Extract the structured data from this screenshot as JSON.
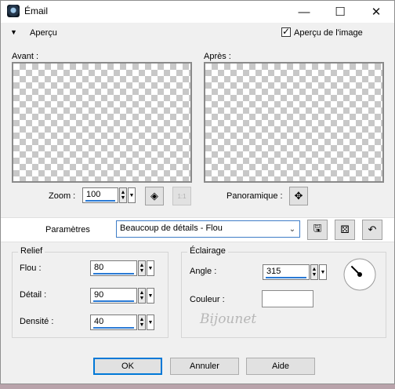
{
  "window": {
    "title": "Émail",
    "controls": {
      "minimize": "—",
      "maximize": "☐",
      "close": "✕"
    }
  },
  "preview": {
    "toggle_label": "Aperçu",
    "checkbox_label": "Aperçu de l'image",
    "checkbox_checked": true,
    "before_label": "Avant :",
    "after_label": "Après :"
  },
  "zoom": {
    "label": "Zoom :",
    "value": "100",
    "pan_label": "Panoramique :"
  },
  "params": {
    "label": "Paramètres",
    "preset": "Beaucoup de détails - Flou"
  },
  "relief": {
    "title": "Relief",
    "blur_label": "Flou :",
    "blur_value": "80",
    "detail_label": "Détail :",
    "detail_value": "90",
    "density_label": "Densité :",
    "density_value": "40"
  },
  "lighting": {
    "title": "Éclairage",
    "angle_label": "Angle :",
    "angle_value": "315",
    "color_label": "Couleur :",
    "color_value": "#ffffff"
  },
  "watermark": "Bijounet",
  "buttons": {
    "ok": "OK",
    "cancel": "Annuler",
    "help": "Aide"
  }
}
